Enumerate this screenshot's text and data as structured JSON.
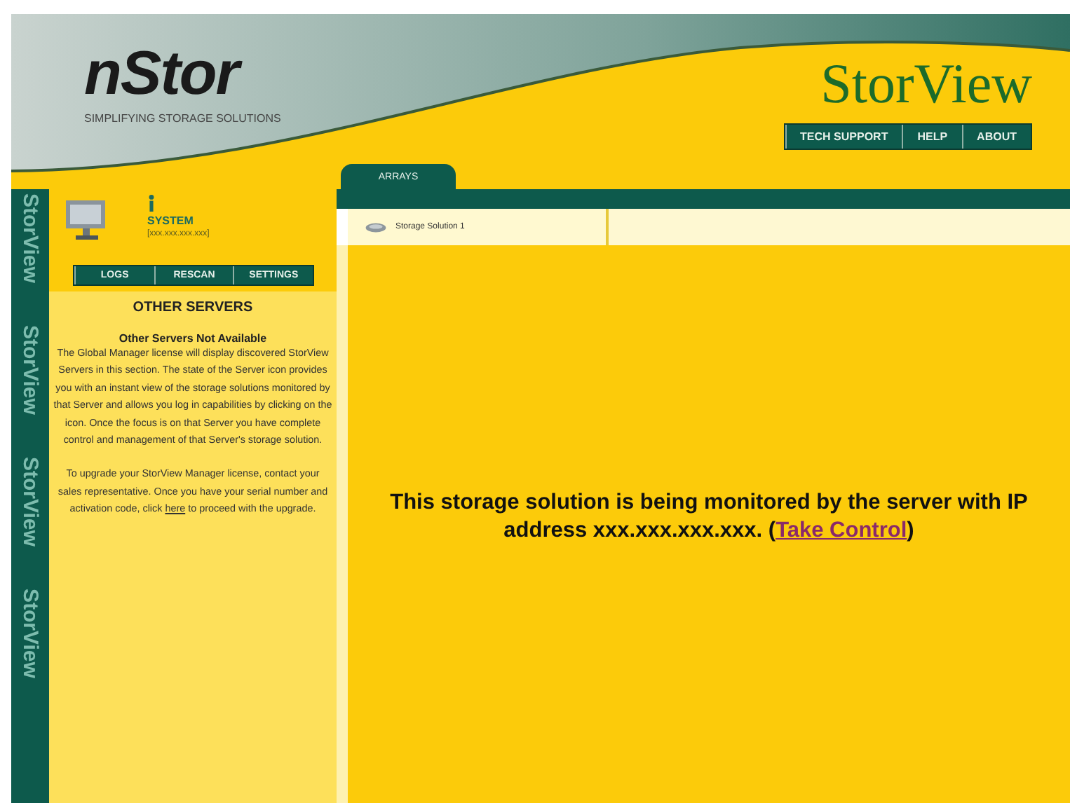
{
  "header": {
    "logo": "nStor",
    "tagline": "SIMPLIFYING STORAGE SOLUTIONS",
    "product_logo": "StorView",
    "nav_buttons": [
      "TECH SUPPORT",
      "HELP",
      "ABOUT"
    ]
  },
  "side_strip": [
    "StorView",
    "StorView",
    "StorView",
    "StorView"
  ],
  "sidebar": {
    "server_name": "SYSTEM",
    "server_address": "[xxx.xxx.xxx.xxx]",
    "buttons": [
      "LOGS",
      "RESCAN",
      "SETTINGS"
    ],
    "section_title": "OTHER SERVERS",
    "notice_title": "Other Servers Not Available",
    "notice_text": "The Global Manager license will display discovered StorView Servers in this section. The state of the Server icon provides you with an instant view of the storage solutions monitored by that Server and allows you log in capabilities by clicking on the icon. Once the focus is on that Server you have complete control and management of that Server's storage solution.",
    "upgrade_text_before": "To upgrade your StorView Manager license, contact your sales representative. Once you have your serial number and activation code, click",
    "upgrade_link": "here",
    "upgrade_text_after": "to proceed with the upgrade."
  },
  "main_tabs": [
    {
      "label": "ARRAYS",
      "selected": true
    }
  ],
  "sub_tabs": [
    {
      "label": "Storage Solution 1",
      "selected": true
    }
  ],
  "message": {
    "text": "This storage solution is being monitored by the server with IP address xxx.xxx.xxx.xxx. (",
    "link": "Take Control",
    "after": ")"
  }
}
